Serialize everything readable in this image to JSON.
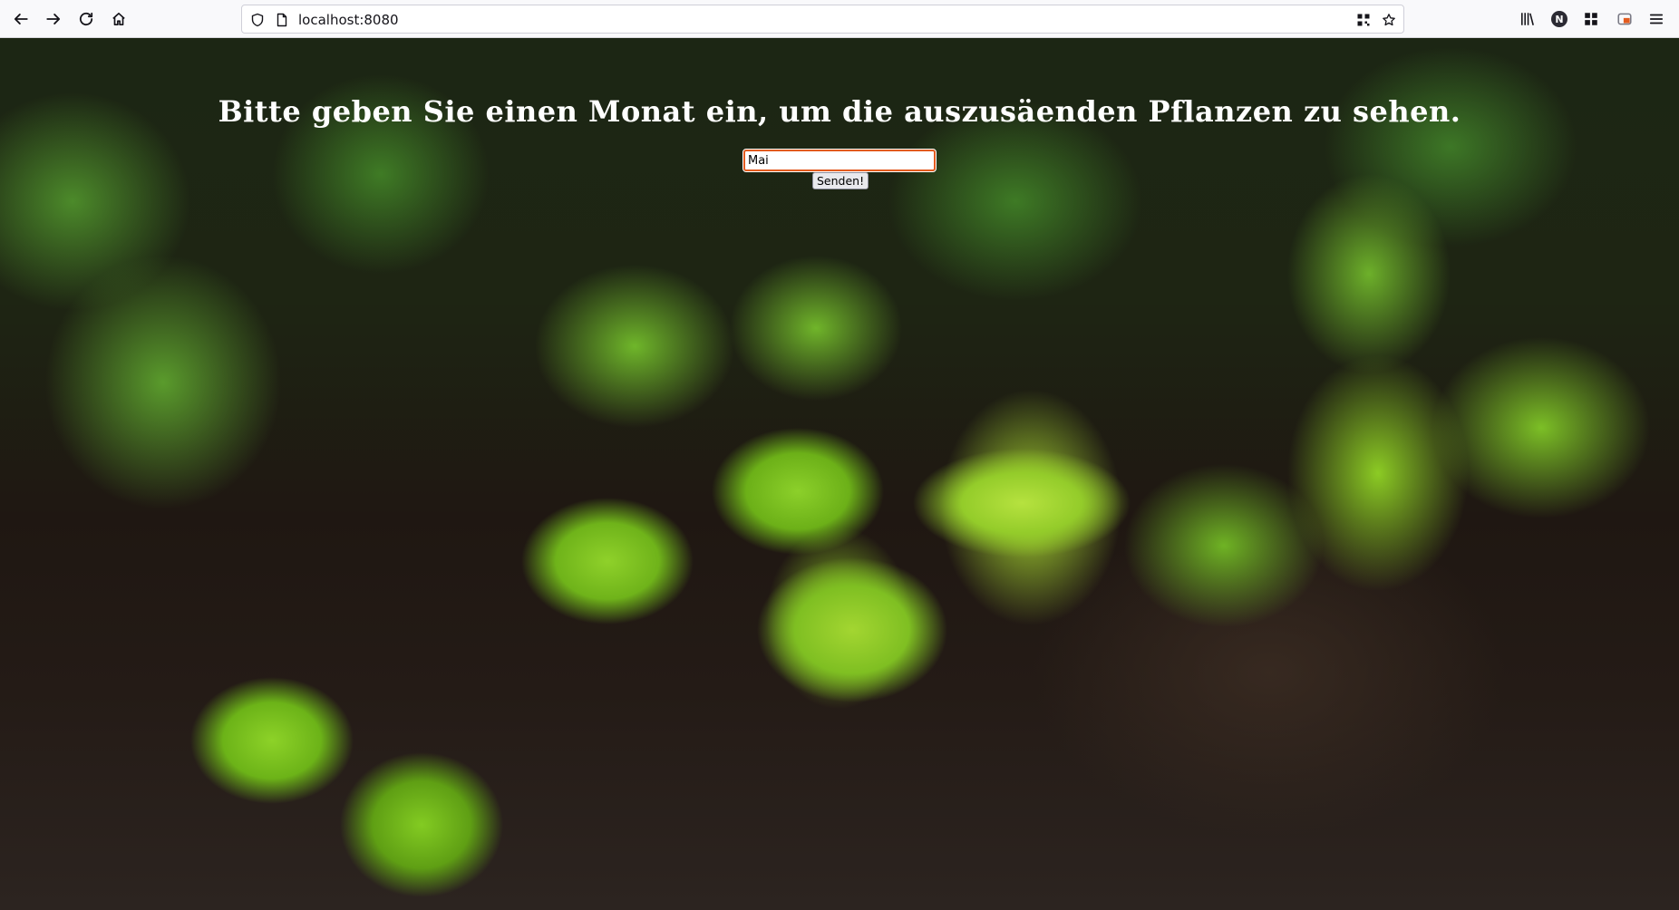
{
  "browser": {
    "url": "localhost:8080",
    "avatar_letter": "N",
    "icons": {
      "back": "arrow-left-icon",
      "forward": "arrow-right-icon",
      "reload": "reload-icon",
      "home": "home-icon",
      "tracking": "shield-icon",
      "page": "page-icon",
      "qr": "qr-code-icon",
      "bookmark": "star-icon",
      "library": "library-icon",
      "extensions": "extensions-icon",
      "screenshot": "screenshot-icon",
      "menu": "hamburger-menu-icon"
    }
  },
  "page": {
    "heading": "Bitte geben Sie einen Monat ein, um die auszusäenden Pflanzen zu sehen.",
    "month_input_value": "Mai",
    "submit_label": "Senden!",
    "colors": {
      "heading": "#ffffff",
      "input_focus_border": "#e35b1f"
    }
  }
}
